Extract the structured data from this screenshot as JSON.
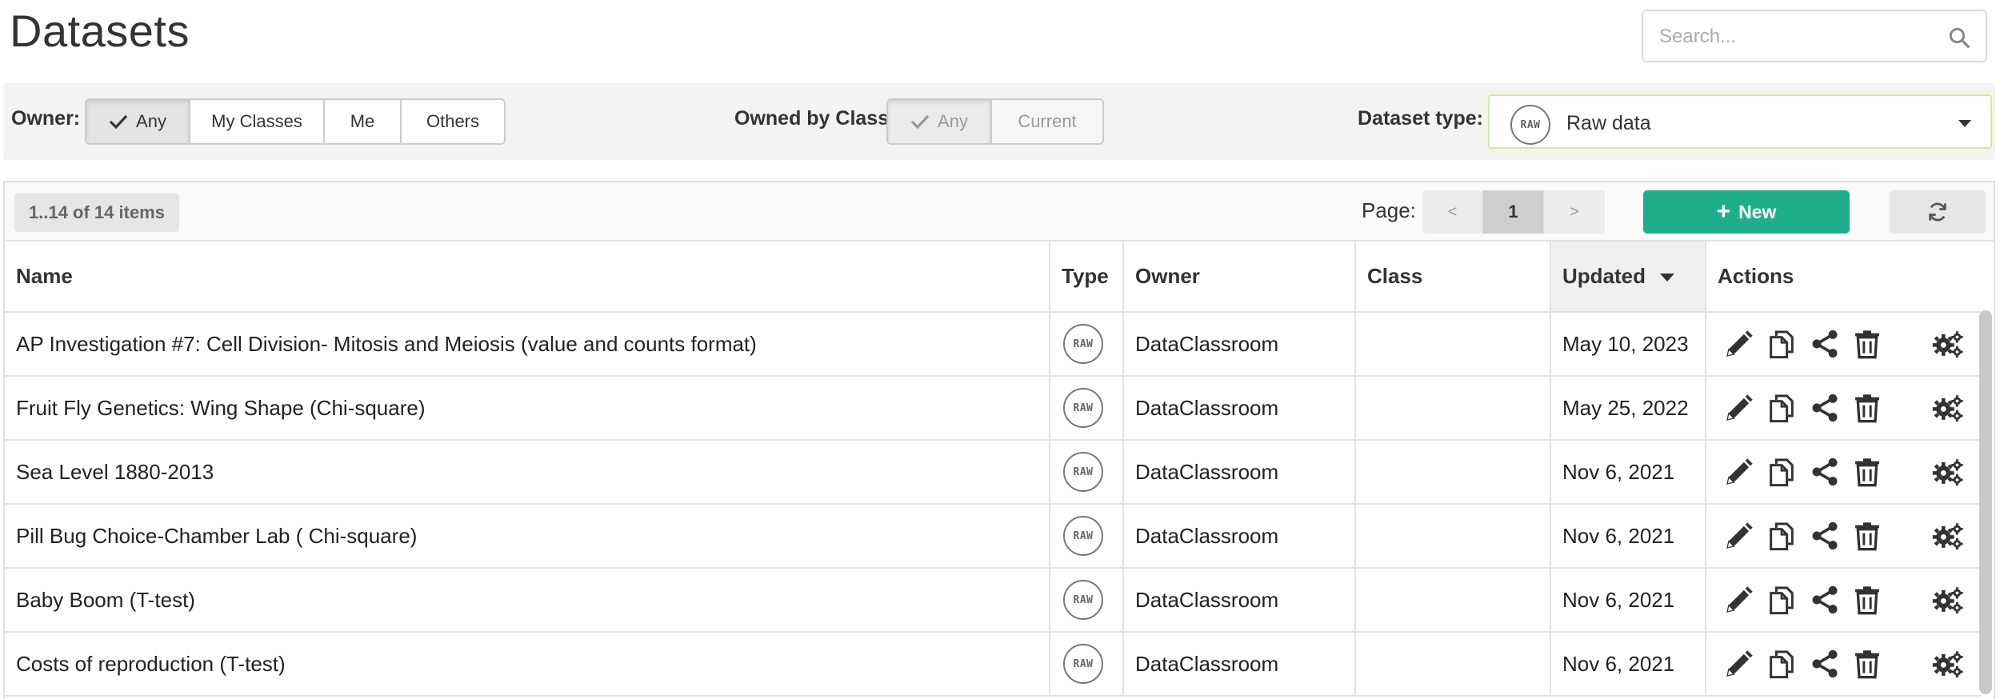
{
  "header": {
    "title": "Datasets",
    "search_placeholder": "Search..."
  },
  "filters": {
    "owner_label": "Owner:",
    "owner_options": [
      "Any",
      "My Classes",
      "Me",
      "Others"
    ],
    "owner_selected": "Any",
    "class_label": "Owned by Class:",
    "class_options": [
      "Any",
      "Current"
    ],
    "class_selected": "Any",
    "type_label": "Dataset type:",
    "type_selected": "Raw data",
    "type_badge": "RAW"
  },
  "toolbar": {
    "count": "1..14 of 14 items",
    "page_label": "Page:",
    "prev": "<",
    "current_page": "1",
    "next": ">",
    "new_label": "New"
  },
  "table": {
    "columns": [
      "Name",
      "Type",
      "Owner",
      "Class",
      "Updated",
      "Actions"
    ],
    "sorted_column": "Updated",
    "rows": [
      {
        "name": "AP Investigation #7: Cell Division- Mitosis and Meiosis (value and counts format)",
        "type": "RAW",
        "owner": "DataClassroom",
        "class": "",
        "updated": "May 10, 2023"
      },
      {
        "name": "Fruit Fly Genetics: Wing Shape (Chi-square)",
        "type": "RAW",
        "owner": "DataClassroom",
        "class": "",
        "updated": "May 25, 2022"
      },
      {
        "name": "Sea Level 1880-2013",
        "type": "RAW",
        "owner": "DataClassroom",
        "class": "",
        "updated": "Nov 6, 2021"
      },
      {
        "name": "Pill Bug Choice-Chamber Lab ( Chi-square)",
        "type": "RAW",
        "owner": "DataClassroom",
        "class": "",
        "updated": "Nov 6, 2021"
      },
      {
        "name": "Baby Boom (T-test)",
        "type": "RAW",
        "owner": "DataClassroom",
        "class": "",
        "updated": "Nov 6, 2021"
      },
      {
        "name": "Costs of reproduction (T-test)",
        "type": "RAW",
        "owner": "DataClassroom",
        "class": "",
        "updated": "Nov 6, 2021"
      }
    ]
  },
  "icons": {
    "search": "search-icon",
    "check": "check-icon",
    "plus": "plus-icon",
    "refresh": "refresh-icon",
    "edit": "pencil-icon",
    "copy": "copy-icon",
    "share": "share-icon",
    "delete": "trash-icon",
    "settings": "gears-icon"
  },
  "colors": {
    "primary": "#1fae8c",
    "text": "#333333",
    "muted": "#999999",
    "border": "#e2e2e2"
  }
}
